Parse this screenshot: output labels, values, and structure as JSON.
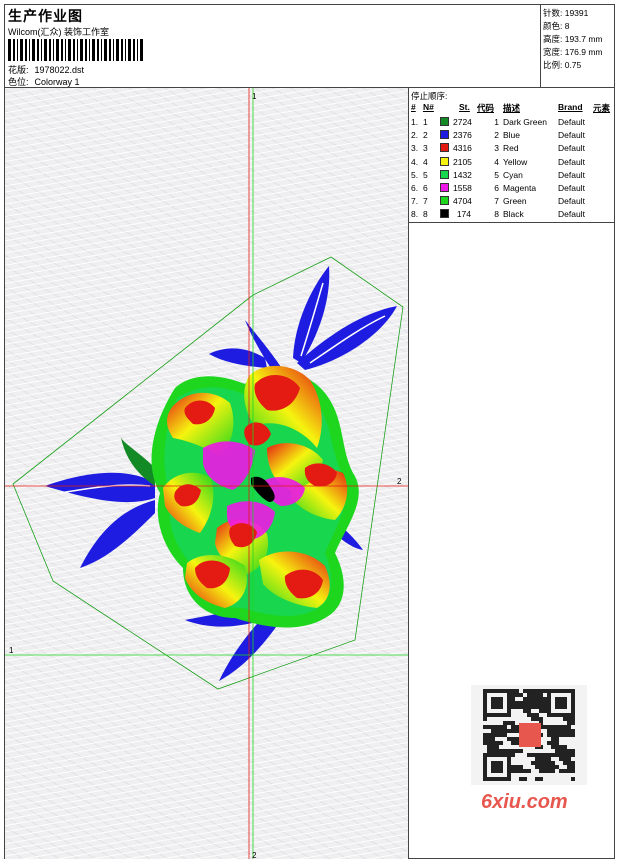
{
  "header": {
    "title": "生产作业图",
    "company": "Wilcom(汇众) 装饰工作室",
    "design_label": "花版:",
    "design_value": "1978022.dst",
    "colorway_label": "色位:",
    "colorway_value": "Colorway 1"
  },
  "stats": {
    "stitches": "针数: 19391",
    "colors": "颜色: 8",
    "height": "高度: 193.7 mm",
    "width": "宽度: 176.9 mm",
    "scale": "比例: 0.75"
  },
  "axes": {
    "v_top": "1",
    "v_bottom": "2",
    "h_left": "1",
    "h_right": "2"
  },
  "color_table": {
    "header": "停止顺序:",
    "columns": [
      "#",
      "N#",
      "St.",
      "代码",
      "描述",
      "Brand",
      "元素"
    ],
    "rows": [
      {
        "idx": "1.",
        "n": "1",
        "color": "#138a25",
        "st": "2724",
        "code": "1",
        "desc": "Dark Green",
        "brand": "Default"
      },
      {
        "idx": "2.",
        "n": "2",
        "color": "#1d1ce0",
        "st": "2376",
        "code": "2",
        "desc": "Blue",
        "brand": "Default"
      },
      {
        "idx": "3.",
        "n": "3",
        "color": "#e41b12",
        "st": "4316",
        "code": "3",
        "desc": "Red",
        "brand": "Default"
      },
      {
        "idx": "4.",
        "n": "4",
        "color": "#f6f40f",
        "st": "2105",
        "code": "4",
        "desc": "Yellow",
        "brand": "Default"
      },
      {
        "idx": "5.",
        "n": "5",
        "color": "#18d64e",
        "st": "1432",
        "code": "5",
        "desc": "Cyan",
        "brand": "Default"
      },
      {
        "idx": "6.",
        "n": "6",
        "color": "#ee18e6",
        "st": "1558",
        "code": "6",
        "desc": "Magenta",
        "brand": "Default"
      },
      {
        "idx": "7.",
        "n": "7",
        "color": "#1dd61d",
        "st": "4704",
        "code": "7",
        "desc": "Green",
        "brand": "Default"
      },
      {
        "idx": "8.",
        "n": "8",
        "color": "#000000",
        "st": "174",
        "code": "8",
        "desc": "Black",
        "brand": "Default"
      }
    ]
  },
  "watermark": "6xiu.com",
  "qr_seal": "刺绣图案"
}
